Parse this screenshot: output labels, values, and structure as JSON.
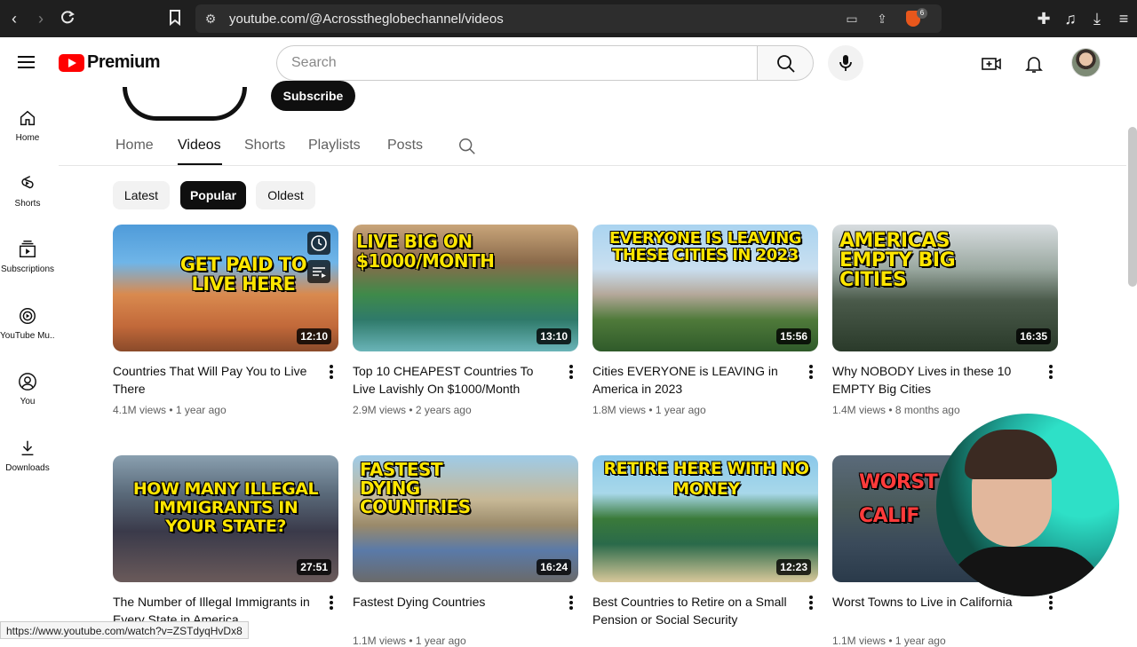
{
  "browser": {
    "url": "youtube.com/@Acrosstheglobechannel/videos",
    "extension_badge": "6",
    "status_url": "https://www.youtube.com/watch?v=ZSTdyqHvDx8"
  },
  "header": {
    "logo_text": "Premium",
    "search_placeholder": "Search"
  },
  "rail": {
    "items": [
      {
        "label": "Home"
      },
      {
        "label": "Shorts"
      },
      {
        "label": "Subscriptions"
      },
      {
        "label": "YouTube Mu..."
      },
      {
        "label": "You"
      },
      {
        "label": "Downloads"
      }
    ]
  },
  "channel": {
    "subscribe_label": "Subscribe",
    "tabs": [
      "Home",
      "Videos",
      "Shorts",
      "Playlists",
      "Posts"
    ],
    "active_tab": "Videos"
  },
  "filters": {
    "chips": [
      "Latest",
      "Popular",
      "Oldest"
    ],
    "active": "Popular"
  },
  "videos": [
    {
      "thumb_text": "GET PAID TO LIVE HERE",
      "duration": "12:10",
      "title": "Countries That Will Pay You to Live There",
      "views": "4.1M views",
      "age": "1 year ago"
    },
    {
      "thumb_text": "LIVE BIG ON $1000/MONTH",
      "duration": "13:10",
      "title": "Top 10 CHEAPEST Countries To Live Lavishly On $1000/Month",
      "views": "2.9M views",
      "age": "2 years ago"
    },
    {
      "thumb_text": "EVERYONE IS LEAVING THESE CITIES IN 2023",
      "duration": "15:56",
      "title": "Cities EVERYONE is LEAVING in America in 2023",
      "views": "1.8M views",
      "age": "1 year ago"
    },
    {
      "thumb_text": "AMERICAS EMPTY BIG CITIES",
      "duration": "16:35",
      "title": "Why NOBODY Lives in these 10 EMPTY Big Cities",
      "views": "1.4M views",
      "age": "8 months ago"
    },
    {
      "thumb_text": "HOW MANY ILLEGAL IMMIGRANTS IN YOUR STATE?",
      "duration": "27:51",
      "title": "The Number of Illegal Immigrants in Every State in America",
      "views": "",
      "age": ""
    },
    {
      "thumb_text": "FASTEST DYING COUNTRIES",
      "duration": "16:24",
      "title": "Fastest Dying Countries",
      "views": "1.1M views",
      "age": "1 year ago"
    },
    {
      "thumb_text": "RETIRE HERE WITH NO MONEY",
      "duration": "12:23",
      "title": "Best Countries to Retire on a Small Pension or Social Security",
      "views": "",
      "age": ""
    },
    {
      "thumb_text": "WORST CALIF",
      "duration": "",
      "title": "Worst Towns to Live in California",
      "views": "1.1M views",
      "age": "1 year ago"
    }
  ],
  "colors": {
    "brand_red": "#ff0000",
    "text_primary": "#0f0f0f",
    "text_secondary": "#606060",
    "browser_bar": "#1f1f1f"
  }
}
